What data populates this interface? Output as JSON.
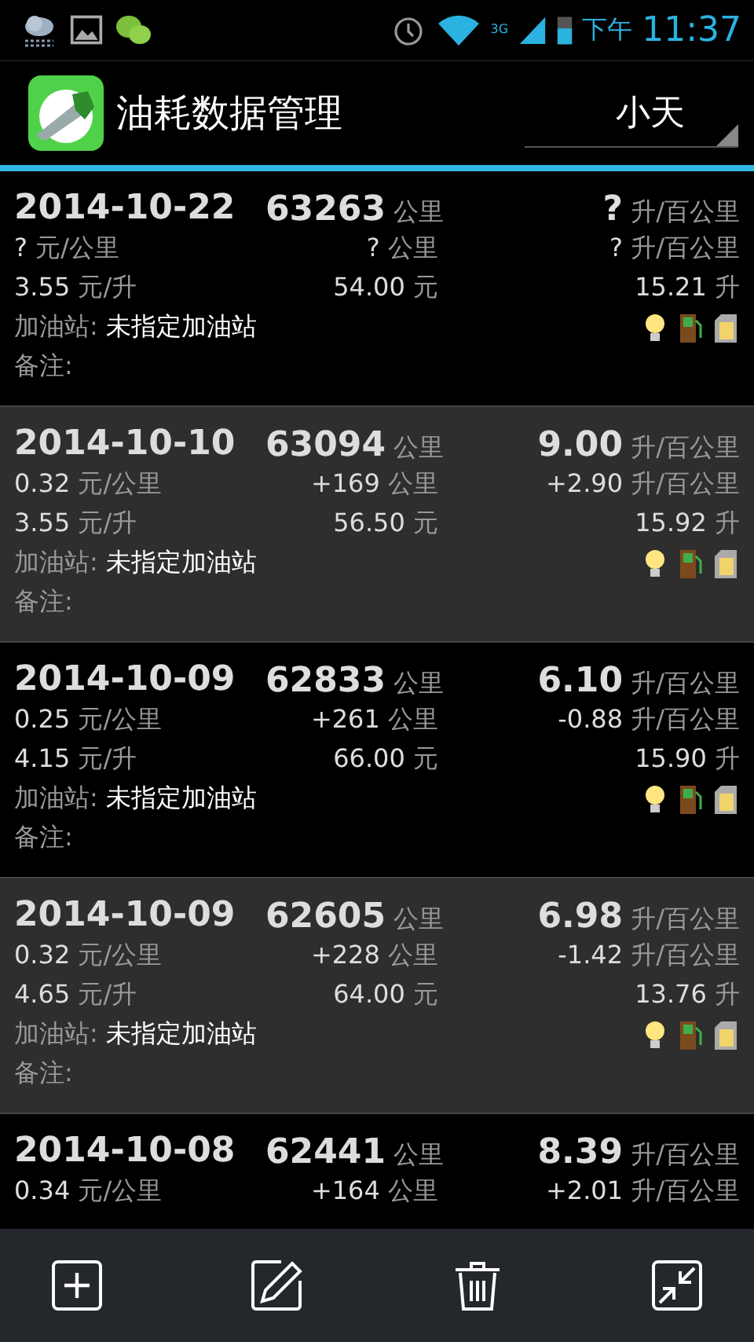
{
  "status_bar": {
    "period": "下午",
    "time": "11:37",
    "network": "3G"
  },
  "action_bar": {
    "title": "油耗数据管理",
    "account": "小天"
  },
  "records": [
    {
      "date": "2014-10-22",
      "odometer": {
        "v": "63263",
        "u": "公里"
      },
      "consumption": {
        "v": "?",
        "u": "升/百公里"
      },
      "cost_per_km": {
        "v": "?",
        "u": "元/公里"
      },
      "distance": {
        "v": "?",
        "u": "公里"
      },
      "consumption_change": {
        "v": "?",
        "u": "升/百公里"
      },
      "price": {
        "v": "3.55",
        "u": "元/升"
      },
      "amount": {
        "v": "54.00",
        "u": "元"
      },
      "volume": {
        "v": "15.21",
        "u": "升"
      },
      "station_label": "加油站:",
      "station": "未指定加油站",
      "note_label": "备注:"
    },
    {
      "date": "2014-10-10",
      "odometer": {
        "v": "63094",
        "u": "公里"
      },
      "consumption": {
        "v": "9.00",
        "u": "升/百公里"
      },
      "cost_per_km": {
        "v": "0.32",
        "u": "元/公里"
      },
      "distance": {
        "v": "+169",
        "u": "公里"
      },
      "consumption_change": {
        "v": "+2.90",
        "u": "升/百公里"
      },
      "price": {
        "v": "3.55",
        "u": "元/升"
      },
      "amount": {
        "v": "56.50",
        "u": "元"
      },
      "volume": {
        "v": "15.92",
        "u": "升"
      },
      "station_label": "加油站:",
      "station": "未指定加油站",
      "note_label": "备注:"
    },
    {
      "date": "2014-10-09",
      "odometer": {
        "v": "62833",
        "u": "公里"
      },
      "consumption": {
        "v": "6.10",
        "u": "升/百公里"
      },
      "cost_per_km": {
        "v": "0.25",
        "u": "元/公里"
      },
      "distance": {
        "v": "+261",
        "u": "公里"
      },
      "consumption_change": {
        "v": "-0.88",
        "u": "升/百公里"
      },
      "price": {
        "v": "4.15",
        "u": "元/升"
      },
      "amount": {
        "v": "66.00",
        "u": "元"
      },
      "volume": {
        "v": "15.90",
        "u": "升"
      },
      "station_label": "加油站:",
      "station": "未指定加油站",
      "note_label": "备注:"
    },
    {
      "date": "2014-10-09",
      "odometer": {
        "v": "62605",
        "u": "公里"
      },
      "consumption": {
        "v": "6.98",
        "u": "升/百公里"
      },
      "cost_per_km": {
        "v": "0.32",
        "u": "元/公里"
      },
      "distance": {
        "v": "+228",
        "u": "公里"
      },
      "consumption_change": {
        "v": "-1.42",
        "u": "升/百公里"
      },
      "price": {
        "v": "4.65",
        "u": "元/升"
      },
      "amount": {
        "v": "64.00",
        "u": "元"
      },
      "volume": {
        "v": "13.76",
        "u": "升"
      },
      "station_label": "加油站:",
      "station": "未指定加油站",
      "note_label": "备注:"
    },
    {
      "date": "2014-10-08",
      "odometer": {
        "v": "62441",
        "u": "公里"
      },
      "consumption": {
        "v": "8.39",
        "u": "升/百公里"
      },
      "cost_per_km": {
        "v": "0.34",
        "u": "元/公里"
      },
      "distance": {
        "v": "+164",
        "u": "公里"
      },
      "consumption_change": {
        "v": "+2.01",
        "u": "升/百公里"
      }
    }
  ]
}
